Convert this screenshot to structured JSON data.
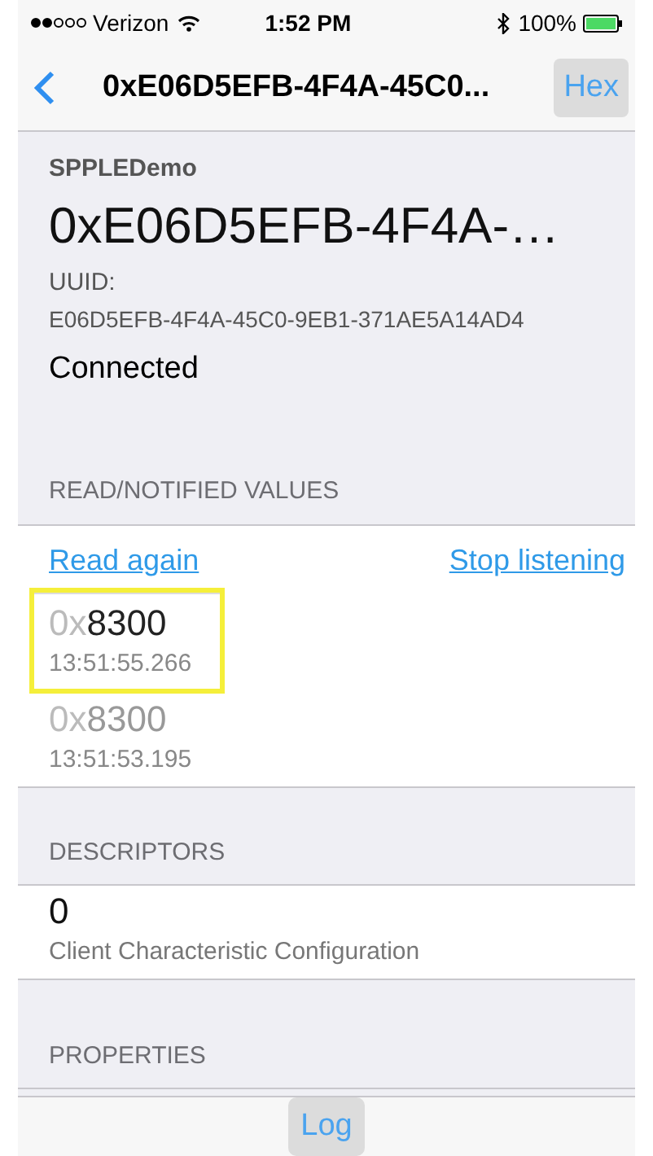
{
  "status_bar": {
    "signal": {
      "level": 0.4
    },
    "carrier": "Verizon",
    "time": "1:52 PM",
    "battery_text": "100%"
  },
  "nav": {
    "title": "0xE06D5EFB-4F4A-45C0...",
    "right_button": "Hex"
  },
  "header": {
    "service": "SPPLEDemo",
    "name": "0xE06D5EFB-4F4A-…",
    "uuid_label": "UUID:",
    "uuid": "E06D5EFB-4F4A-45C0-9EB1-371AE5A14AD4",
    "status": "Connected"
  },
  "values_section": {
    "title": "READ/NOTIFIED VALUES",
    "read_link": "Read again",
    "stop_link": "Stop listening",
    "values": [
      {
        "prefix": "0x",
        "value": "8300",
        "time": "13:51:55.266",
        "selected": true
      },
      {
        "prefix": "0x",
        "value": "8300",
        "time": "13:51:53.195",
        "selected": false
      }
    ]
  },
  "descriptors_section": {
    "title": "DESCRIPTORS",
    "items": [
      {
        "value": "0",
        "name": "Client Characteristic Configuration"
      }
    ]
  },
  "properties_section": {
    "title": "PROPERTIES"
  },
  "toolbar": {
    "button": "Log"
  }
}
